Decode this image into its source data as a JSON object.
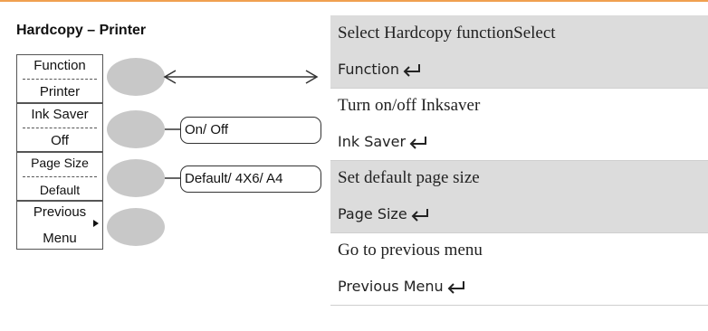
{
  "header": {
    "title": "Hardcopy – Printer"
  },
  "menu": [
    {
      "name": "Function",
      "value": "Printer"
    },
    {
      "name": "Ink Saver",
      "value": "Off"
    },
    {
      "name": "Page Size",
      "value": "Default"
    },
    {
      "name": "Previous",
      "value": "Menu"
    }
  ],
  "options": {
    "ink_saver": "On/ Off",
    "page_size": "Default/ 4X6/ A4"
  },
  "descriptions": [
    {
      "text": "Select Hardcopy functionSelect",
      "key": "Function"
    },
    {
      "text": "Turn on/off Inksaver",
      "key": "Ink Saver"
    },
    {
      "text": "Set default page size",
      "key": "Page Size"
    },
    {
      "text": "Go to previous menu",
      "key": "Previous Menu"
    }
  ],
  "icons": {
    "enter": "enter-return-icon",
    "submenu": "submenu-triangle-icon",
    "arrow": "double-arrow-icon"
  },
  "colors": {
    "accent_line": "#f0a050",
    "shade": "#dcdcdc",
    "button": "#c8c8c8"
  }
}
